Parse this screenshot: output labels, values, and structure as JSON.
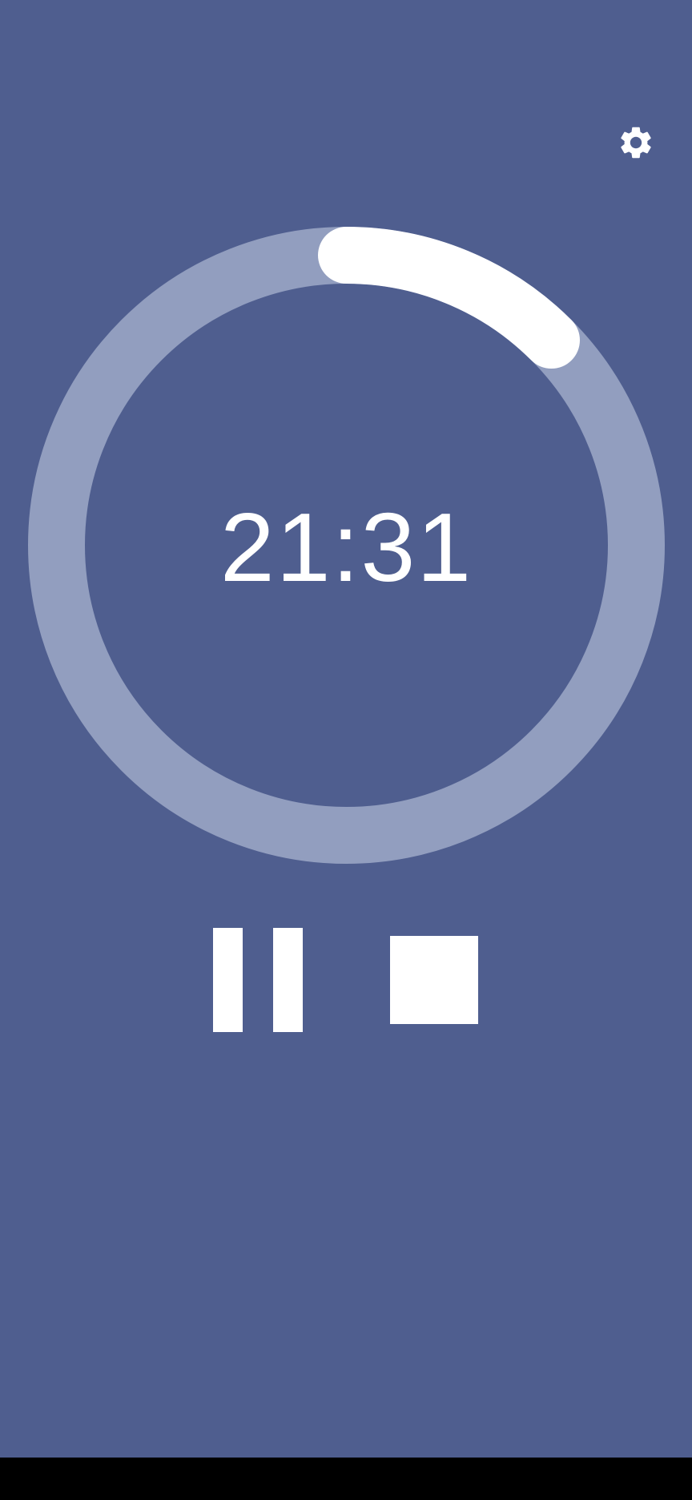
{
  "timer": {
    "remaining": "21:31",
    "progress_fraction": 0.125
  },
  "colors": {
    "background": "#4f5e8f",
    "ring_track": "#929ebf",
    "ring_progress": "#ffffff",
    "foreground": "#ffffff",
    "nav_bar": "#000000"
  },
  "icons": {
    "settings": "gear-icon",
    "pause": "pause-icon",
    "stop": "stop-icon"
  }
}
